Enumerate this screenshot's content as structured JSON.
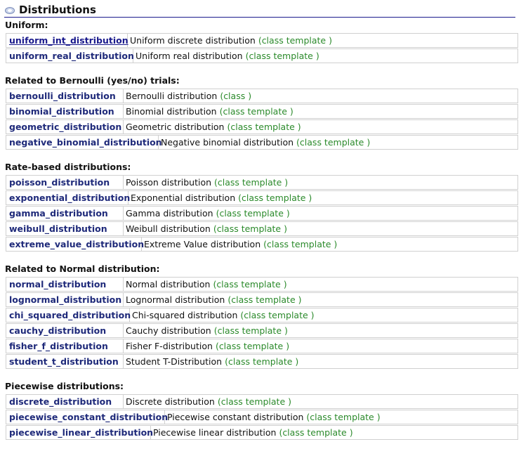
{
  "page": {
    "title": "Distributions"
  },
  "sections": [
    {
      "header": "Uniform:",
      "rows": [
        {
          "name": "uniform_int_distribution",
          "desc": "Uniform discrete distribution",
          "type": "(class template )"
        },
        {
          "name": "uniform_real_distribution",
          "desc": "Uniform real distribution",
          "type": "(class template )"
        }
      ]
    },
    {
      "header": "Related to Bernoulli (yes/no) trials:",
      "rows": [
        {
          "name": "bernoulli_distribution",
          "desc": "Bernoulli distribution",
          "type": "(class )"
        },
        {
          "name": "binomial_distribution",
          "desc": "Binomial distribution",
          "type": "(class template )"
        },
        {
          "name": "geometric_distribution",
          "desc": "Geometric distribution",
          "type": "(class template )"
        },
        {
          "name": "negative_binomial_distribution",
          "desc": "Negative binomial distribution",
          "type": "(class template )"
        }
      ]
    },
    {
      "header": "Rate-based distributions:",
      "rows": [
        {
          "name": "poisson_distribution",
          "desc": "Poisson distribution",
          "type": "(class template )"
        },
        {
          "name": "exponential_distribution",
          "desc": "Exponential distribution",
          "type": "(class template )"
        },
        {
          "name": "gamma_distribution",
          "desc": "Gamma distribution",
          "type": "(class template )"
        },
        {
          "name": "weibull_distribution",
          "desc": "Weibull distribution",
          "type": "(class template )"
        },
        {
          "name": "extreme_value_distribution",
          "desc": "Extreme Value distribution",
          "type": "(class template )"
        }
      ]
    },
    {
      "header": "Related to Normal distribution:",
      "rows": [
        {
          "name": "normal_distribution",
          "desc": "Normal distribution",
          "type": "(class template )"
        },
        {
          "name": "lognormal_distribution",
          "desc": "Lognormal distribution",
          "type": "(class template )"
        },
        {
          "name": "chi_squared_distribution",
          "desc": "Chi-squared distribution",
          "type": "(class template )"
        },
        {
          "name": "cauchy_distribution",
          "desc": "Cauchy distribution",
          "type": "(class template )"
        },
        {
          "name": "fisher_f_distribution",
          "desc": "Fisher F-distribution",
          "type": "(class template )"
        },
        {
          "name": "student_t_distribution",
          "desc": "Student T-Distribution",
          "type": "(class template )"
        }
      ]
    },
    {
      "header": "Piecewise distributions:",
      "rows": [
        {
          "name": "discrete_distribution",
          "desc": "Discrete distribution",
          "type": "(class template )"
        },
        {
          "name": "piecewise_constant_distribution",
          "desc": "Piecewise constant distribution",
          "type": "(class template )"
        },
        {
          "name": "piecewise_linear_distribution",
          "desc": "Piecewise linear distribution",
          "type": "(class template )"
        }
      ]
    }
  ],
  "colors": {
    "link": "#1a1a8c",
    "type": "#2b8a2b",
    "border": "#d0d0d0"
  },
  "icons": {
    "title": "section-bullet-icon"
  }
}
